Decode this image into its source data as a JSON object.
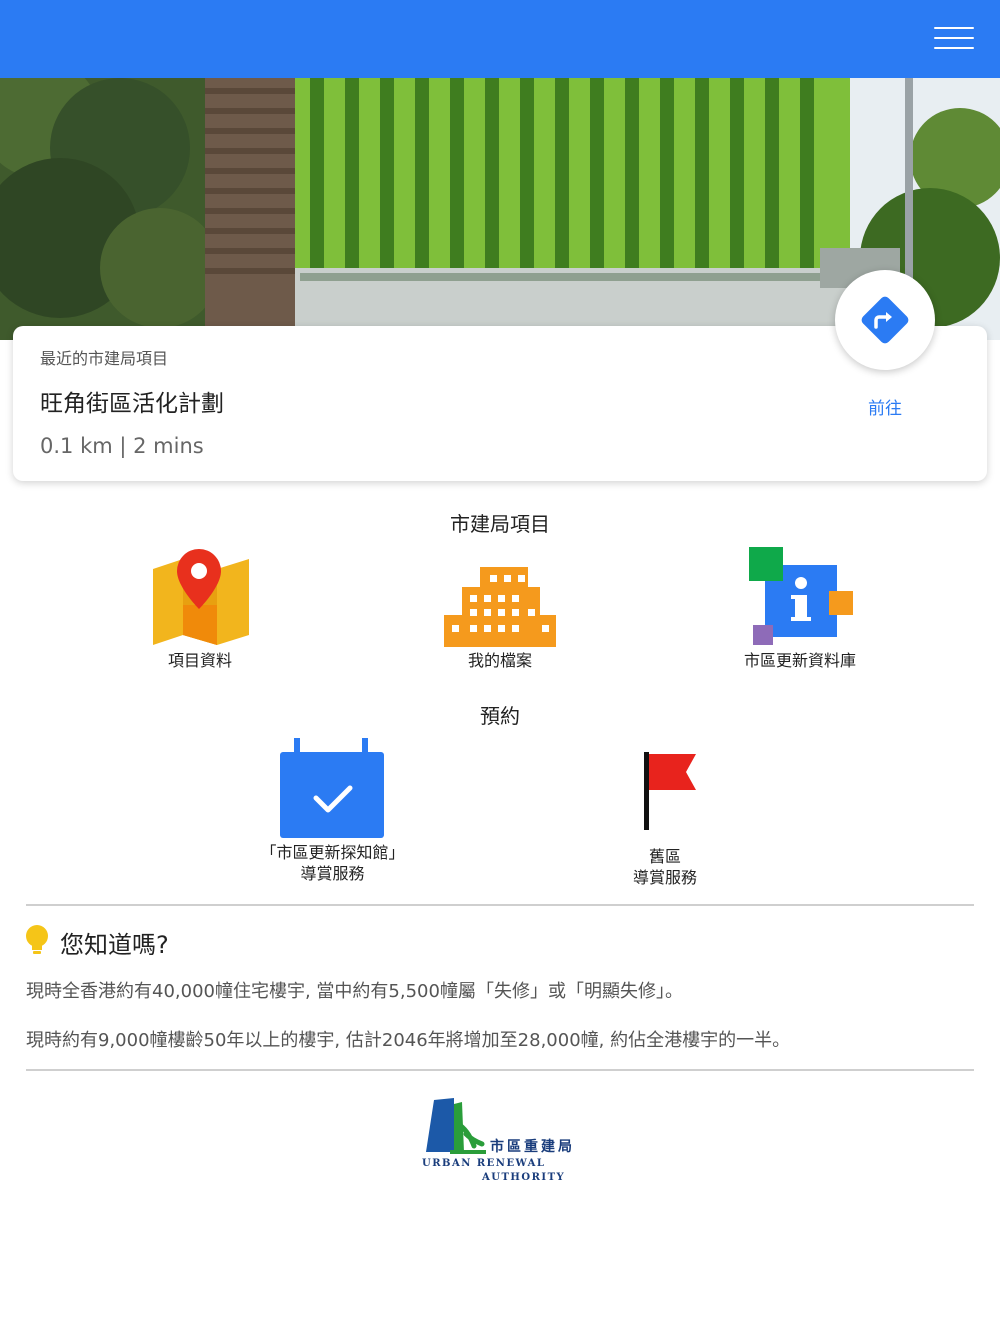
{
  "colors": {
    "header": "#2b7bf3",
    "accent": "#2b7bf3"
  },
  "header": {
    "menu_icon": "hamburger-menu-icon"
  },
  "nearest": {
    "label": "最近的市建局項目",
    "title": "旺角街區活化計劃",
    "distance": "0.1 km | 2 mins",
    "go_label": "前往",
    "go_icon": "directions-icon"
  },
  "projects": {
    "title": "市建局項目",
    "items": [
      {
        "label": "項目資料",
        "icon": "map-pin-icon"
      },
      {
        "label": "我的檔案",
        "icon": "building-icon"
      },
      {
        "label": "市區更新資料庫",
        "icon": "info-icon"
      }
    ]
  },
  "booking": {
    "title": "預約",
    "items": [
      {
        "line1": "「市區更新探知館」",
        "line2": "導賞服務",
        "icon": "calendar-check-icon"
      },
      {
        "line1": "舊區",
        "line2": "導賞服務",
        "icon": "flag-icon"
      }
    ]
  },
  "did_you_know": {
    "title": "您知道嗎?",
    "icon": "lightbulb-icon",
    "facts": [
      "現時全香港約有40,000幢住宅樓宇, 當中約有5,500幢屬「失修」或「明顯失修」。",
      "現時約有9,000幢樓齡50年以上的樓宇, 估計2046年將增加至28,000幢, 約佔全港樓宇的一半。"
    ]
  },
  "logo": {
    "name_cn": "市區重建局",
    "name_en_1": "URBAN RENEWAL",
    "name_en_2": "AUTHORITY"
  }
}
